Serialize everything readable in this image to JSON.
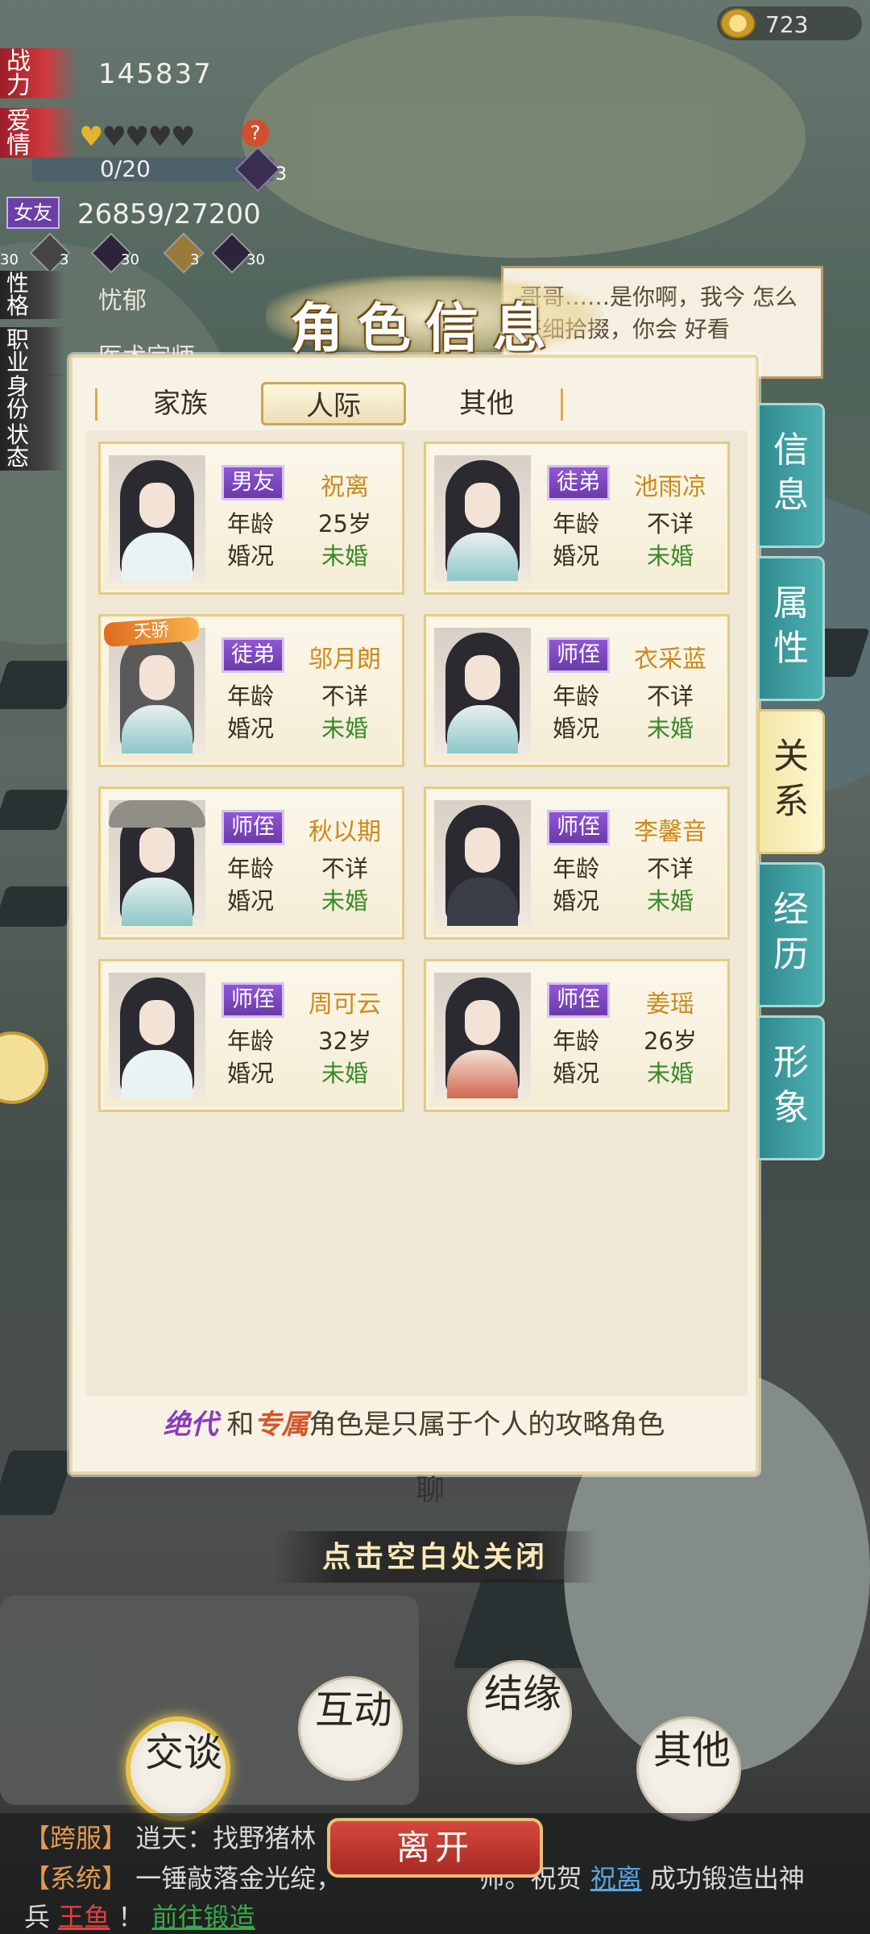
{
  "currency": {
    "value": "723",
    "icon": "teacup-coin-icon"
  },
  "stats": {
    "power_label": "战力",
    "power_value": "145837",
    "love_label": "爱情",
    "love_hearts_filled": 1,
    "love_hearts_total": 5,
    "love_progress": "0/20",
    "love_item_count": "3",
    "girlfriend_label": "女友",
    "girlfriend_value": "26859/27200",
    "items": [
      {
        "count": "30"
      },
      {
        "count": "3"
      },
      {
        "count": "30"
      },
      {
        "count": "3"
      },
      {
        "count": "30"
      }
    ],
    "traits": [
      {
        "label": "性格",
        "value": "忧郁"
      },
      {
        "label": "职业",
        "value": "医术宗师"
      },
      {
        "label": "身份",
        "value": ""
      },
      {
        "label": "状态",
        "value": ""
      }
    ]
  },
  "bubble": {
    "text": "哥哥……是你啊，我今 怎么仔细拾掇，你会 好看"
  },
  "panel": {
    "title": "角色信息",
    "tabs": [
      {
        "label": "家族",
        "active": false
      },
      {
        "label": "人际",
        "active": true
      },
      {
        "label": "其他",
        "active": false
      }
    ],
    "age_label": "年龄",
    "marital_label": "婚况",
    "characters": [
      {
        "relation": "男友",
        "name": "祝离",
        "age": "25岁",
        "marital": "未婚",
        "badge": ""
      },
      {
        "relation": "徒弟",
        "name": "池雨凉",
        "age": "不详",
        "marital": "未婚",
        "badge": ""
      },
      {
        "relation": "徒弟",
        "name": "邬月朗",
        "age": "不详",
        "marital": "未婚",
        "badge": "天骄"
      },
      {
        "relation": "师侄",
        "name": "衣采蓝",
        "age": "不详",
        "marital": "未婚",
        "badge": ""
      },
      {
        "relation": "师侄",
        "name": "秋以期",
        "age": "不详",
        "marital": "未婚",
        "badge": ""
      },
      {
        "relation": "师侄",
        "name": "李馨音",
        "age": "不详",
        "marital": "未婚",
        "badge": ""
      },
      {
        "relation": "师侄",
        "name": "周可云",
        "age": "32岁",
        "marital": "未婚",
        "badge": ""
      },
      {
        "relation": "师侄",
        "name": "姜瑶",
        "age": "26岁",
        "marital": "未婚",
        "badge": ""
      }
    ],
    "footer": {
      "jd": "绝代",
      "and": "和",
      "zs": "专属",
      "rest": "角色是只属于个人的攻略角色"
    }
  },
  "side_tabs": [
    {
      "label": "信息",
      "active": false
    },
    {
      "label": "属性",
      "active": false
    },
    {
      "label": "关系",
      "active": true
    },
    {
      "label": "经历",
      "active": false
    },
    {
      "label": "形象",
      "active": false
    }
  ],
  "bottom": {
    "liao": "聊",
    "close_hint": "点击空白处关闭",
    "actions": [
      "交谈",
      "互动",
      "结缘",
      "其他"
    ],
    "leave": "离开"
  },
  "chat": {
    "line1": {
      "tag": "【跨服】",
      "text": "逍天：找野猪林"
    },
    "line2": {
      "tag": "【系统】",
      "text": "一锤敲落金光绽，",
      "mid": "师。祝贺",
      "link": "祝离",
      "text2": "成功锻造出神"
    },
    "line3": {
      "pre": "兵",
      "red": "王鱼",
      "mid": "！",
      "grn": "前往锻造"
    }
  }
}
